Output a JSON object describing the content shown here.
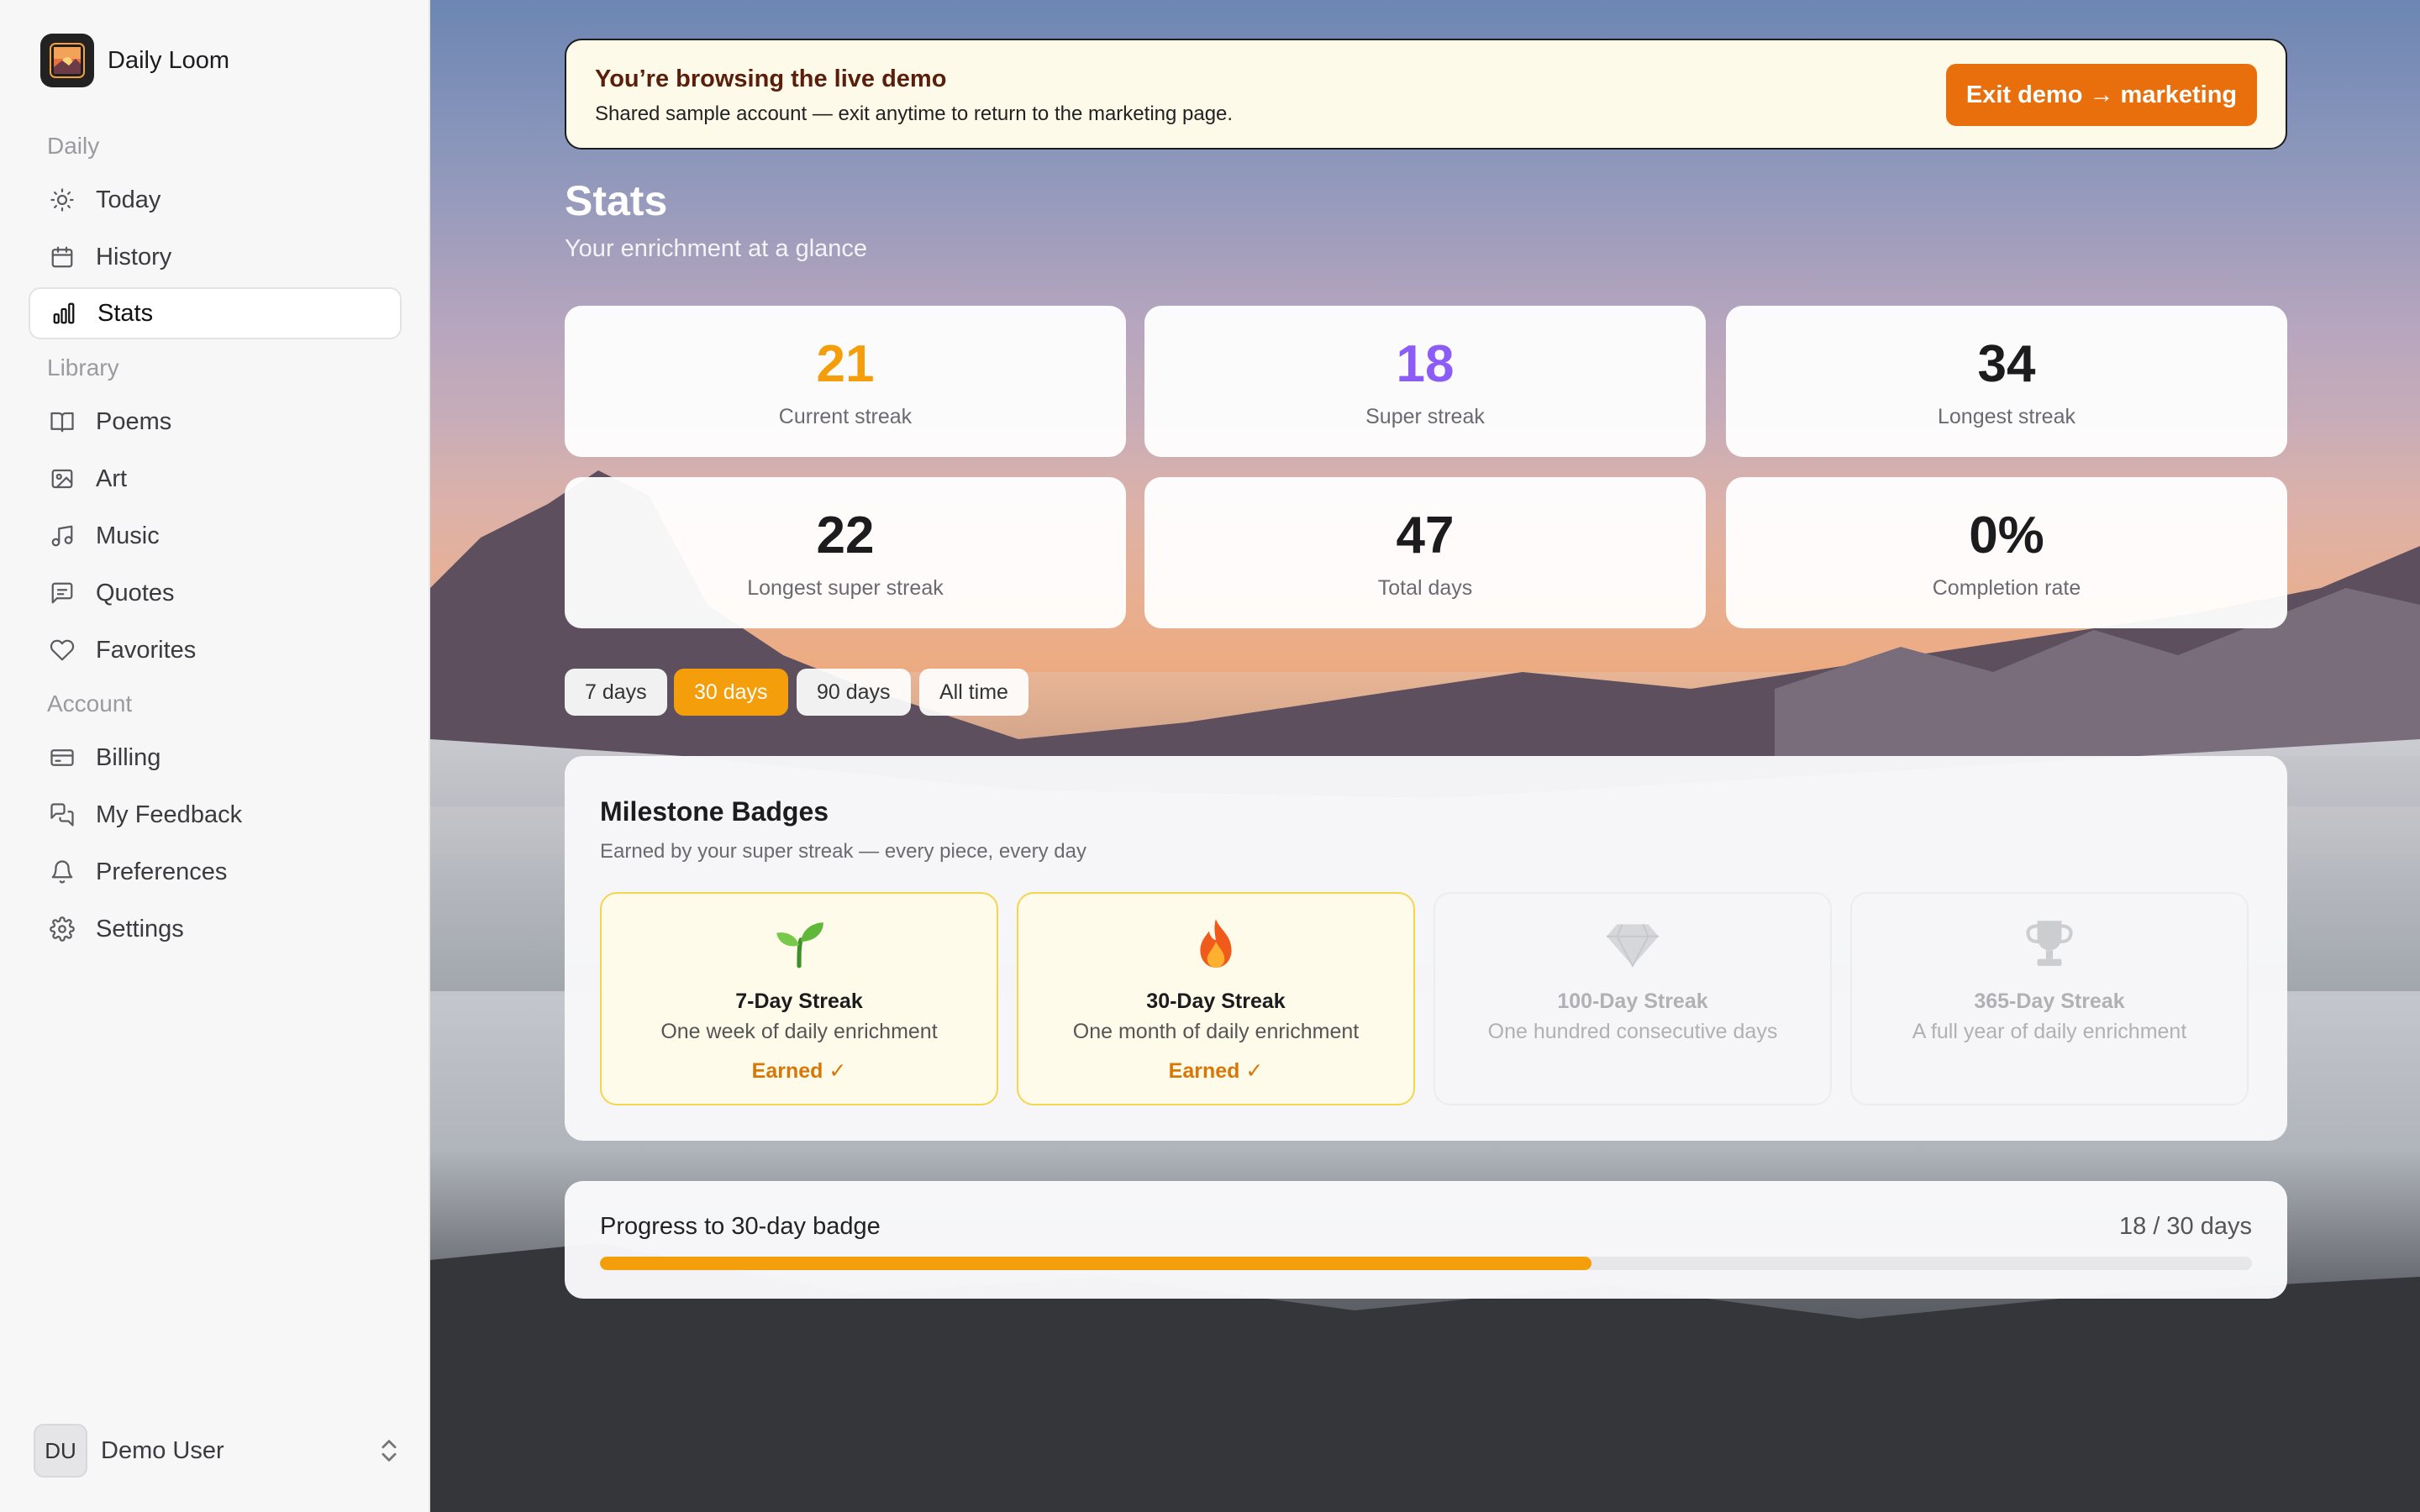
{
  "app": {
    "name": "Daily Loom",
    "logo_icon": "sunset-image-icon"
  },
  "sidebar": {
    "sections": [
      {
        "label": "Daily",
        "items": [
          {
            "label": "Today",
            "icon": "sun-icon",
            "active": false
          },
          {
            "label": "History",
            "icon": "calendar-icon",
            "active": false
          },
          {
            "label": "Stats",
            "icon": "bar-chart-icon",
            "active": true
          }
        ]
      },
      {
        "label": "Library",
        "items": [
          {
            "label": "Poems",
            "icon": "book-icon",
            "active": false
          },
          {
            "label": "Art",
            "icon": "image-icon",
            "active": false
          },
          {
            "label": "Music",
            "icon": "music-note-icon",
            "active": false
          },
          {
            "label": "Quotes",
            "icon": "message-square-icon",
            "active": false
          },
          {
            "label": "Favorites",
            "icon": "heart-icon",
            "active": false
          }
        ]
      },
      {
        "label": "Account",
        "items": [
          {
            "label": "Billing",
            "icon": "credit-card-icon",
            "active": false
          },
          {
            "label": "My Feedback",
            "icon": "messages-icon",
            "active": false
          },
          {
            "label": "Preferences",
            "icon": "bell-icon",
            "active": false
          },
          {
            "label": "Settings",
            "icon": "gear-icon",
            "active": false
          }
        ]
      }
    ],
    "user": {
      "initials": "DU",
      "name": "Demo User"
    }
  },
  "banner": {
    "title": "You’re browsing the live demo",
    "subtitle": "Shared sample account — exit anytime to return to the marketing page.",
    "button_label": "Exit demo → marketing"
  },
  "header": {
    "title": "Stats",
    "subtitle": "Your enrichment at a glance"
  },
  "stats": [
    {
      "value": "21",
      "label": "Current streak",
      "color": "#f59e0b"
    },
    {
      "value": "18",
      "label": "Super streak",
      "color": "#8b5cf6"
    },
    {
      "value": "34",
      "label": "Longest streak",
      "color": "#1c1c1e"
    },
    {
      "value": "22",
      "label": "Longest super streak",
      "color": "#1c1c1e"
    },
    {
      "value": "47",
      "label": "Total days",
      "color": "#1c1c1e"
    },
    {
      "value": "0%",
      "label": "Completion rate",
      "color": "#1c1c1e"
    }
  ],
  "ranges": [
    {
      "label": "7 days",
      "active": false
    },
    {
      "label": "30 days",
      "active": true
    },
    {
      "label": "90 days",
      "active": false
    },
    {
      "label": "All time",
      "active": false
    }
  ],
  "milestones": {
    "title": "Milestone Badges",
    "subtitle": "Earned by your super streak — every piece, every day",
    "badges": [
      {
        "icon": "seedling-icon",
        "name": "7-Day Streak",
        "description": "One week of daily enrichment",
        "status": "Earned ✓",
        "earned": true
      },
      {
        "icon": "fire-icon",
        "name": "30-Day Streak",
        "description": "One month of daily enrichment",
        "status": "Earned ✓",
        "earned": true
      },
      {
        "icon": "diamond-icon",
        "name": "100-Day Streak",
        "description": "One hundred consecutive days",
        "status": "",
        "earned": false
      },
      {
        "icon": "trophy-icon",
        "name": "365-Day Streak",
        "description": "A full year of daily enrichment",
        "status": "",
        "earned": false
      }
    ]
  },
  "progress": {
    "label": "Progress to 30-day badge",
    "count_text": "18 / 30 days",
    "current": 18,
    "target": 30,
    "color": "#f59e0b"
  }
}
